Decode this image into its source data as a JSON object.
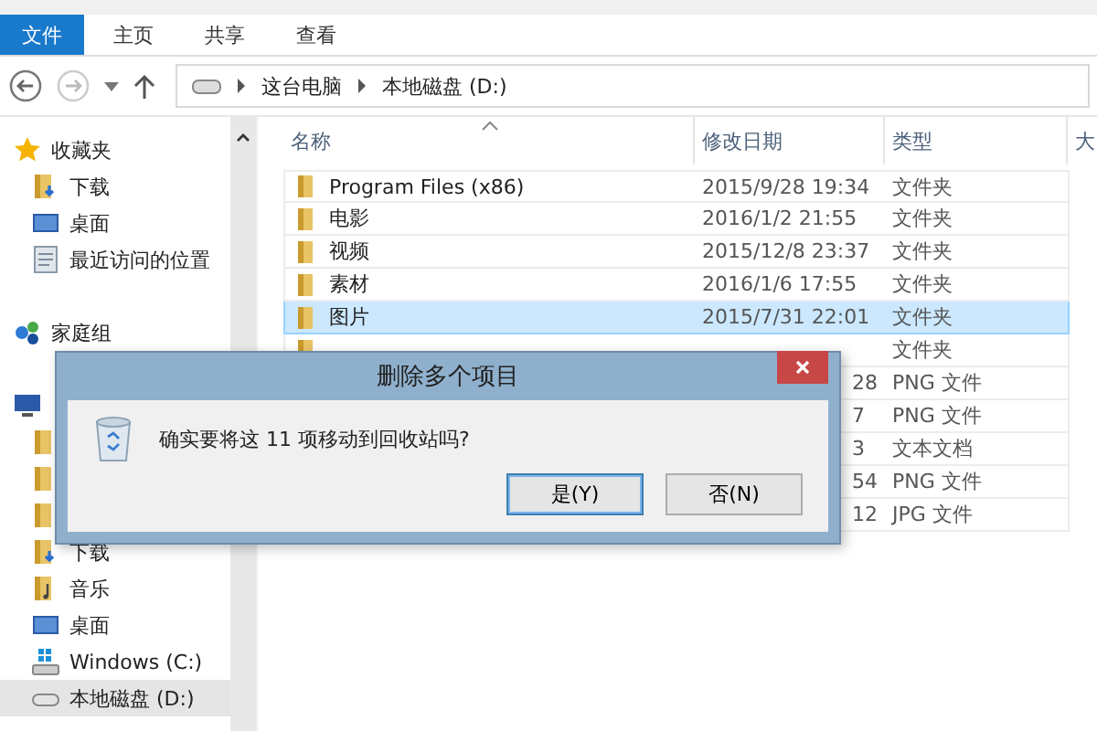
{
  "ribbon": {
    "tabs": [
      {
        "label": "文件",
        "selected": true
      },
      {
        "label": "主页",
        "selected": false
      },
      {
        "label": "共享",
        "selected": false
      },
      {
        "label": "查看",
        "selected": false
      }
    ]
  },
  "address_bar": {
    "path": [
      "这台电脑",
      "本地磁盘 (D:)"
    ]
  },
  "sidebar": {
    "sections": [
      {
        "header": {
          "kind": "star",
          "label": "收藏夹",
          "selected": false
        },
        "children": [
          {
            "kind": "download",
            "label": "下载",
            "selected": false
          },
          {
            "kind": "desktop",
            "label": "桌面",
            "selected": false
          },
          {
            "kind": "recent",
            "label": "最近访问的位置",
            "selected": false
          }
        ]
      },
      {
        "header": {
          "kind": "homegroup",
          "label": "家庭组",
          "selected": false
        }
      },
      {
        "header": {
          "kind": "computer",
          "selected": false
        },
        "children": [
          {
            "kind": "folder",
            "selected": false
          },
          {
            "kind": "folder",
            "selected": false
          },
          {
            "kind": "folder",
            "selected": false
          },
          {
            "kind": "download",
            "label": "下载",
            "selected": false
          },
          {
            "kind": "music",
            "label": "音乐",
            "selected": false
          },
          {
            "kind": "desktop",
            "label": "桌面",
            "selected": false
          },
          {
            "kind": "windows-drive",
            "label": "Windows (C:)",
            "selected": false
          },
          {
            "kind": "drive",
            "label": "本地磁盘 (D:)",
            "selected": true
          }
        ]
      }
    ]
  },
  "table": {
    "columns": [
      "名称",
      "修改日期",
      "类型",
      "大"
    ],
    "rows": [
      {
        "name": "Program Files (x86)",
        "date": "2015/9/28 19:34",
        "type": "文件夹",
        "selected": false
      },
      {
        "name": "电影",
        "date": "2016/1/2 21:55",
        "type": "文件夹",
        "selected": false
      },
      {
        "name": "视频",
        "date": "2015/12/8 23:37",
        "type": "文件夹",
        "selected": false
      },
      {
        "name": "素材",
        "date": "2016/1/6 17:55",
        "type": "文件夹",
        "selected": false
      },
      {
        "name": "图片",
        "date": "2015/7/31 22:01",
        "type": "文件夹",
        "selected": true
      },
      {
        "type": "文件夹",
        "selected": false
      },
      {
        "date_tail": "28",
        "type": "PNG 文件",
        "selected": false
      },
      {
        "date_tail": "7",
        "type": "PNG 文件",
        "selected": false
      },
      {
        "date_tail": "3",
        "type": "文本文档",
        "selected": false
      },
      {
        "date_tail": "54",
        "type": "PNG 文件",
        "selected": false
      },
      {
        "date_tail": "12",
        "type": "JPG 文件",
        "selected": false
      }
    ]
  },
  "dialog": {
    "title": "删除多个项目",
    "message": "确实要将这 11 项移动到回收站吗?",
    "buttons": [
      {
        "label": "是(Y)",
        "selected": true
      },
      {
        "label": "否(N)",
        "selected": false
      }
    ]
  }
}
